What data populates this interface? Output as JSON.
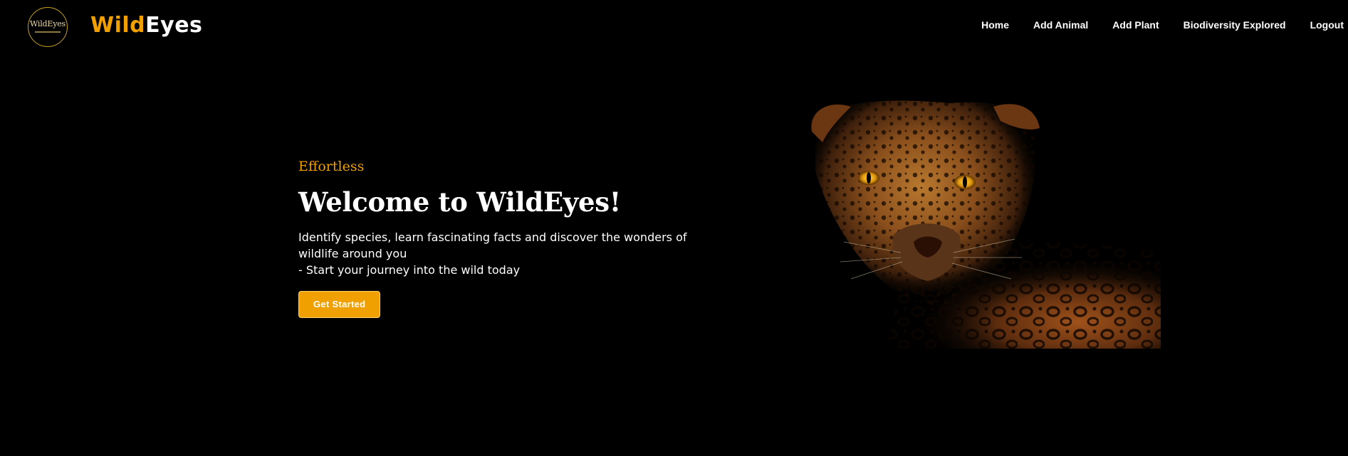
{
  "logo": {
    "seal_text": "WildEyes",
    "brand_part1": "Wild",
    "brand_part2": "Eyes"
  },
  "nav": {
    "items": [
      {
        "label": "Home"
      },
      {
        "label": "Add Animal"
      },
      {
        "label": "Add Plant"
      },
      {
        "label": "Biodiversity Explored"
      },
      {
        "label": "Logout"
      }
    ]
  },
  "hero": {
    "eyebrow": "Effortless",
    "title": "Welcome to WildEyes!",
    "description_line1": "Identify species, learn fascinating facts and discover the wonders of wildlife around you",
    "description_line2": "- Start your journey into the wild today",
    "cta_label": "Get Started",
    "image_subject": "leopard-photo"
  },
  "colors": {
    "background": "#000000",
    "accent": "#f0a000",
    "text": "#ffffff"
  }
}
